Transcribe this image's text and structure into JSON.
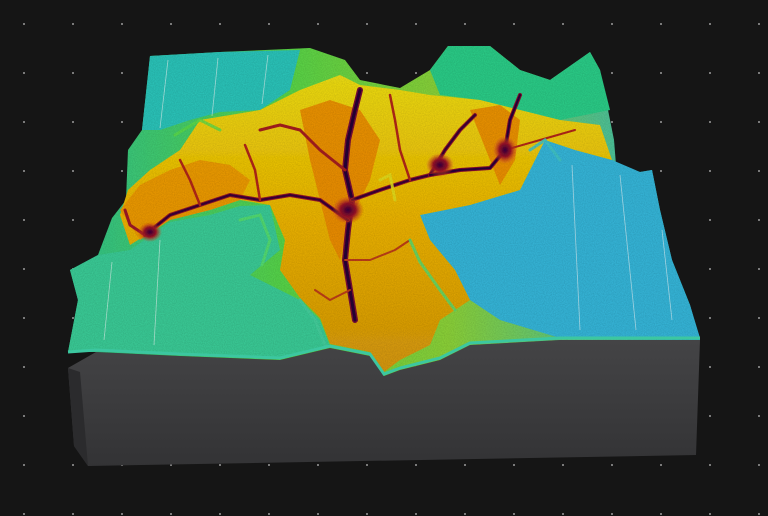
{
  "scene": {
    "background_color": "#151515",
    "grid_dot_color": "#7a7a7a",
    "block_side_color": "#3d3d3e",
    "rim_color": "#3cc7a0",
    "grid_line_color": "#ffffff"
  },
  "terrain": {
    "type": "3d-elevation-relief",
    "color_ramp": [
      "#3ad6ff",
      "#29c8c8",
      "#2fd27d",
      "#9be21b",
      "#f4e417",
      "#f5b800",
      "#e24a12",
      "#8a1030",
      "#2b0a3d"
    ],
    "ramp_order": "high-to-low",
    "valley_network": "dendritic",
    "grid_lines": true
  }
}
